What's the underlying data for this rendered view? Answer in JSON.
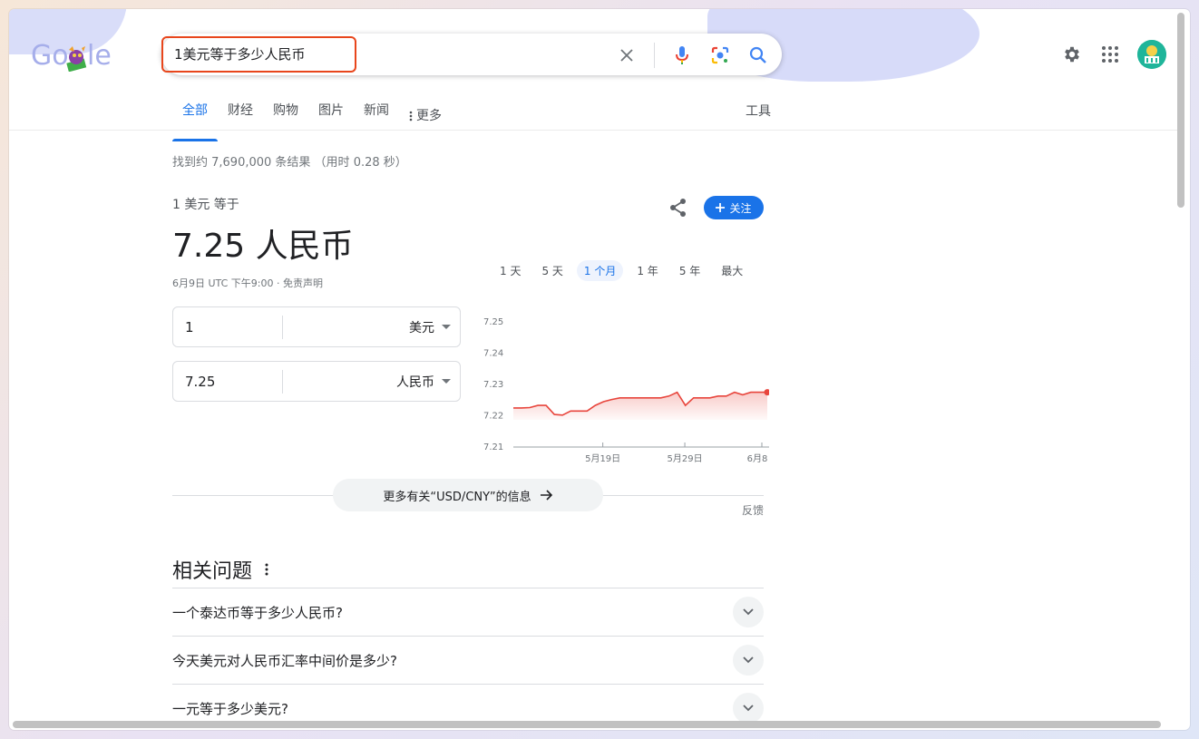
{
  "search": {
    "query": "1美元等于多少人民币"
  },
  "tabs": [
    {
      "label": "全部"
    },
    {
      "label": "财经"
    },
    {
      "label": "购物"
    },
    {
      "label": "图片"
    },
    {
      "label": "新闻"
    },
    {
      "label": "更多"
    }
  ],
  "tools_label": "工具",
  "result_stats": "找到约 7,690,000 条结果 （用时 0.28 秒）",
  "converter": {
    "label": "1 美元 等于",
    "value": "7.25 人民币",
    "date_note": "6月9日 UTC 下午9:00 · 免责声明",
    "follow_label": "关注",
    "from_amount": "1",
    "from_currency": "美元",
    "to_amount": "7.25",
    "to_currency": "人民币"
  },
  "ranges": [
    {
      "label": "1 天"
    },
    {
      "label": "5 天"
    },
    {
      "label": "1 个月"
    },
    {
      "label": "1 年"
    },
    {
      "label": "5 年"
    },
    {
      "label": "最大"
    }
  ],
  "chart_data": {
    "type": "line",
    "title": "",
    "xlabel": "",
    "ylabel": "",
    "x_tick_labels": [
      "5月19日",
      "5月29日",
      "6月8日"
    ],
    "y_tick_labels": [
      "7.25",
      "7.24",
      "7.23",
      "7.22",
      "7.21"
    ],
    "ylim": [
      7.21,
      7.25
    ],
    "series": [
      {
        "values": [
          7.2225,
          7.2225,
          7.2226,
          7.2233,
          7.2233,
          7.2204,
          7.2202,
          7.2215,
          7.2215,
          7.2215,
          7.2233,
          7.2245,
          7.2252,
          7.2257,
          7.2257,
          7.2257,
          7.2257,
          7.2257,
          7.2257,
          7.2263,
          7.2275,
          7.2233,
          7.2257,
          7.2257,
          7.2257,
          7.2263,
          7.2263,
          7.2275,
          7.2267,
          7.2275,
          7.2275,
          7.2275
        ]
      }
    ],
    "line_color": "#e8453c",
    "grid": false
  },
  "more_info_label": "更多有关“USD/CNY”的信息",
  "feedback_label": "反馈",
  "related": {
    "title": "相关问题",
    "questions": [
      {
        "text": "一个泰达币等于多少人民币?"
      },
      {
        "text": "今天美元对人民币汇率中间价是多少?"
      },
      {
        "text": "一元等于多少美元?"
      }
    ]
  },
  "colors": {
    "accent": "#1a73e8",
    "highlight_border": "#e8461c",
    "chart_line": "#e8453c"
  }
}
